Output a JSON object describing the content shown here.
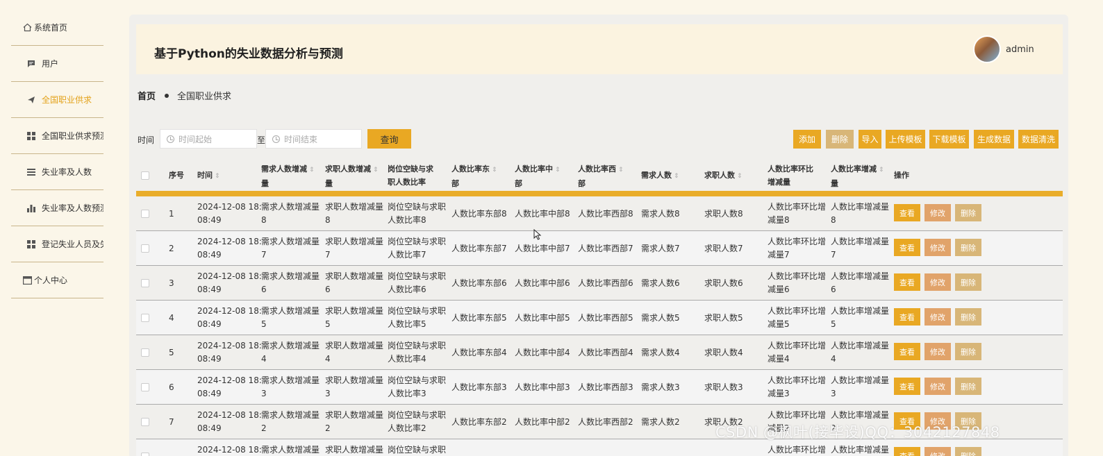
{
  "sidebar": {
    "items": [
      {
        "label": "系统首页",
        "icon": "home-icon"
      },
      {
        "label": "用户",
        "icon": "chat-icon"
      },
      {
        "label": "全国职业供求",
        "icon": "send-icon"
      },
      {
        "label": "全国职业供求预测",
        "icon": "grid-icon"
      },
      {
        "label": "失业率及人数",
        "icon": "list-icon"
      },
      {
        "label": "失业率及人数预测",
        "icon": "bar-chart-icon"
      },
      {
        "label": "登记失业人员及失业",
        "icon": "grid-icon"
      },
      {
        "label": "个人中心",
        "icon": "profile-icon"
      }
    ],
    "active_index": 2
  },
  "header": {
    "title": "基于Python的失业数据分析与预测",
    "username": "admin"
  },
  "breadcrumb": {
    "home": "首页",
    "current": "全国职业供求"
  },
  "toolbar": {
    "time_label": "时间",
    "start_placeholder": "时间起始",
    "to_label": "至",
    "end_placeholder": "时间结束",
    "query_label": "查询",
    "add_label": "添加",
    "delete_label": "删除",
    "import_label": "导入",
    "upload_template_label": "上传模板",
    "download_template_label": "下载模板",
    "generate_label": "生成数据",
    "clean_label": "数据清洗"
  },
  "colors": {
    "accent": "#e9a823",
    "edit": "#e1a36a",
    "delete": "#d8b678",
    "active_nav": "#e3a21a"
  },
  "table": {
    "columns": {
      "index": "序号",
      "time": "时间",
      "c1a": "需求人数增减",
      "c1b": "量",
      "c2a": "求职人数增减",
      "c2b": "量",
      "c3a": "岗位空缺与求",
      "c3b": "职人数比率",
      "c4a": "人数比率东",
      "c4b": "部",
      "c5a": "人数比率中",
      "c5b": "部",
      "c6a": "人数比率西",
      "c6b": "部",
      "c7": "需求人数",
      "c8": "求职人数",
      "c9a": "人数比率环比",
      "c9b": "增减量",
      "c10a": "人数比率增减",
      "c10b": "量",
      "ops": "操作"
    },
    "row_buttons": {
      "view": "查看",
      "edit": "修改",
      "delete": "删除"
    },
    "rows": [
      {
        "idx": "1",
        "t1": "2024-12-08 18:",
        "t2": "08:49",
        "a1": "需求人数增减量",
        "a2": "8",
        "b1": "求职人数增减量",
        "b2": "8",
        "c1": "岗位空缺与求职",
        "c2": "人数比率8",
        "d": "人数比率东部8",
        "e": "人数比率中部8",
        "f": "人数比率西部8",
        "g": "需求人数8",
        "h": "求职人数8",
        "i1": "人数比率环比增",
        "i2": "减量8",
        "j1": "人数比率增减量",
        "j2": "8"
      },
      {
        "idx": "2",
        "t1": "2024-12-08 18:",
        "t2": "08:49",
        "a1": "需求人数增减量",
        "a2": "7",
        "b1": "求职人数增减量",
        "b2": "7",
        "c1": "岗位空缺与求职",
        "c2": "人数比率7",
        "d": "人数比率东部7",
        "e": "人数比率中部7",
        "f": "人数比率西部7",
        "g": "需求人数7",
        "h": "求职人数7",
        "i1": "人数比率环比增",
        "i2": "减量7",
        "j1": "人数比率增减量",
        "j2": "7"
      },
      {
        "idx": "3",
        "t1": "2024-12-08 18:",
        "t2": "08:49",
        "a1": "需求人数增减量",
        "a2": "6",
        "b1": "求职人数增减量",
        "b2": "6",
        "c1": "岗位空缺与求职",
        "c2": "人数比率6",
        "d": "人数比率东部6",
        "e": "人数比率中部6",
        "f": "人数比率西部6",
        "g": "需求人数6",
        "h": "求职人数6",
        "i1": "人数比率环比增",
        "i2": "减量6",
        "j1": "人数比率增减量",
        "j2": "6"
      },
      {
        "idx": "4",
        "t1": "2024-12-08 18:",
        "t2": "08:49",
        "a1": "需求人数增减量",
        "a2": "5",
        "b1": "求职人数增减量",
        "b2": "5",
        "c1": "岗位空缺与求职",
        "c2": "人数比率5",
        "d": "人数比率东部5",
        "e": "人数比率中部5",
        "f": "人数比率西部5",
        "g": "需求人数5",
        "h": "求职人数5",
        "i1": "人数比率环比增",
        "i2": "减量5",
        "j1": "人数比率增减量",
        "j2": "5"
      },
      {
        "idx": "5",
        "t1": "2024-12-08 18:",
        "t2": "08:49",
        "a1": "需求人数增减量",
        "a2": "4",
        "b1": "求职人数增减量",
        "b2": "4",
        "c1": "岗位空缺与求职",
        "c2": "人数比率4",
        "d": "人数比率东部4",
        "e": "人数比率中部4",
        "f": "人数比率西部4",
        "g": "需求人数4",
        "h": "求职人数4",
        "i1": "人数比率环比增",
        "i2": "减量4",
        "j1": "人数比率增减量",
        "j2": "4"
      },
      {
        "idx": "6",
        "t1": "2024-12-08 18:",
        "t2": "08:49",
        "a1": "需求人数增减量",
        "a2": "3",
        "b1": "求职人数增减量",
        "b2": "3",
        "c1": "岗位空缺与求职",
        "c2": "人数比率3",
        "d": "人数比率东部3",
        "e": "人数比率中部3",
        "f": "人数比率西部3",
        "g": "需求人数3",
        "h": "求职人数3",
        "i1": "人数比率环比增",
        "i2": "减量3",
        "j1": "人数比率增减量",
        "j2": "3"
      },
      {
        "idx": "7",
        "t1": "2024-12-08 18:",
        "t2": "08:49",
        "a1": "需求人数增减量",
        "a2": "2",
        "b1": "求职人数增减量",
        "b2": "2",
        "c1": "岗位空缺与求职",
        "c2": "人数比率2",
        "d": "人数比率东部2",
        "e": "人数比率中部2",
        "f": "人数比率西部2",
        "g": "需求人数2",
        "h": "求职人数2",
        "i1": "人数比率环比增",
        "i2": "减量2",
        "j1": "人数比率增减量",
        "j2": "2"
      },
      {
        "idx": "",
        "t1": "2024-12-08 18:",
        "t2": "",
        "a1": "需求人数增减量",
        "a2": "",
        "b1": "求职人数增减量",
        "b2": "",
        "c1": "岗位空缺与求职",
        "c2": "",
        "d": "",
        "e": "",
        "f": "",
        "g": "",
        "h": "",
        "i1": "人数比率环比增",
        "i2": "",
        "j1": "人数比率增减量",
        "j2": ""
      }
    ]
  },
  "watermark": "CSDN @枫叶(接毕设)QQ：3042127848"
}
